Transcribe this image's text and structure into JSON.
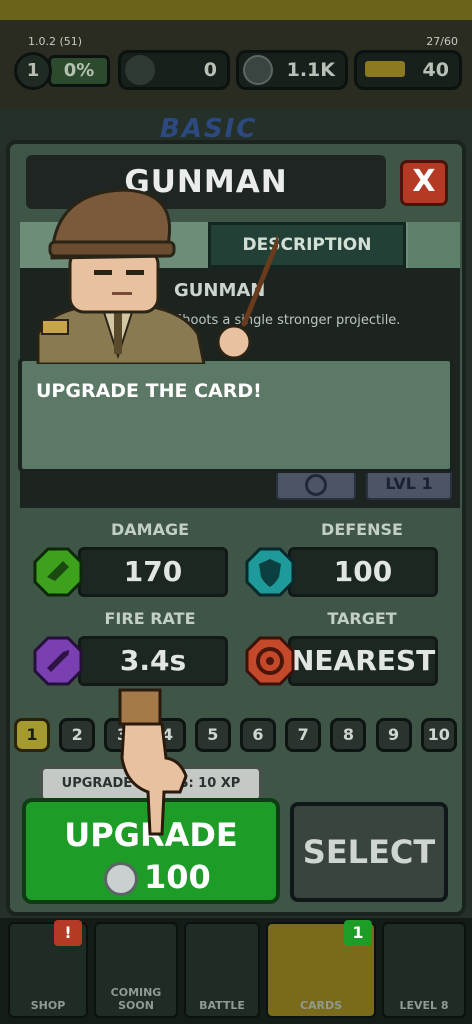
{
  "top_bar": {
    "version": "1.0.2 (51)",
    "counter": "27/60",
    "level": "1",
    "xp_percent": "0%",
    "cash": "0",
    "coins": "1.1K",
    "gold": "40"
  },
  "background": {
    "tab_label": "BASIC"
  },
  "modal": {
    "title": "GUNMAN",
    "close_label": "X",
    "tab_description": "DESCRIPTION",
    "card_name": "GUNMAN",
    "card_description": "Shoots a single stronger projectile.",
    "level_pill": "LVL 1"
  },
  "tooltip": {
    "text": "UPGRADE THE CARD!"
  },
  "stats": {
    "damage_label": "DAMAGE",
    "damage_value": "170",
    "defense_label": "DEFENSE",
    "defense_value": "100",
    "firerate_label": "FIRE RATE",
    "firerate_value": "3.4s",
    "target_label": "TARGET",
    "target_value": "NEAREST"
  },
  "levels": [
    "1",
    "2",
    "3",
    "4",
    "5",
    "6",
    "7",
    "8",
    "9",
    "10"
  ],
  "current_level_index": 0,
  "upgrade": {
    "cost_note": "UPGRADE BONUS: 10 XP",
    "button_label": "UPGRADE",
    "price": "100"
  },
  "select_button": "SELECT",
  "nav": {
    "shop": "SHOP",
    "coming_soon": "COMING SOON",
    "battle": "BATTLE",
    "cards": "CARDS",
    "level8": "LEVEL 8",
    "shop_badge": "!",
    "cards_badge": "1"
  },
  "colors": {
    "accent_green": "#1d9c28",
    "close_red": "#b53a26",
    "damage_icon": "#3ea11e",
    "defense_icon": "#1e9a9a",
    "firerate_icon": "#7a3fb0",
    "target_icon": "#c4492a"
  }
}
